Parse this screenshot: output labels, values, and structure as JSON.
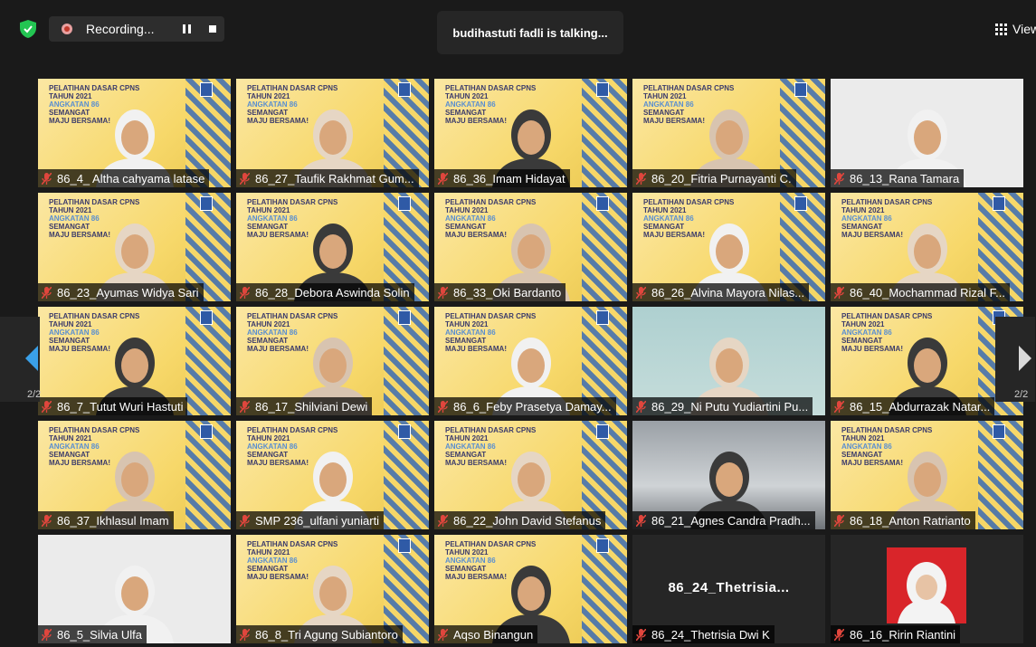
{
  "top_bar": {
    "recording_label": "Recording...",
    "talking_indicator": "budihastuti fadli is talking...",
    "view_label": "View"
  },
  "navigation": {
    "left_page": "2/2",
    "right_page": "2/2"
  },
  "participants": [
    {
      "name": "86_4_ Altha cahyama latase",
      "bg": "poster"
    },
    {
      "name": "86_27_Taufik Rakhmat Gum...",
      "bg": "poster"
    },
    {
      "name": "86_36_Imam Hidayat",
      "bg": "poster"
    },
    {
      "name": "86_20_Fitria Purnayanti C.",
      "bg": "poster"
    },
    {
      "name": "86_13_Rana Tamara",
      "bg": "light"
    },
    {
      "name": "86_23_Ayumas Widya Sari",
      "bg": "poster"
    },
    {
      "name": "86_28_Debora Aswinda Solin",
      "bg": "poster"
    },
    {
      "name": "86_33_Oki Bardanto",
      "bg": "poster"
    },
    {
      "name": "86_26_Alvina Mayora Nilas...",
      "bg": "poster"
    },
    {
      "name": "86_40_Mochammad Rizal F...",
      "bg": "poster"
    },
    {
      "name": "86_7_Tutut Wuri Hastuti",
      "bg": "poster"
    },
    {
      "name": "86_17_Shilviani Dewi",
      "bg": "poster"
    },
    {
      "name": "86_6_Feby Prasetya Damay...",
      "bg": "poster"
    },
    {
      "name": "86_29_Ni Putu Yudiartini Pu...",
      "bg": "teal"
    },
    {
      "name": "86_15_Abdurrazak Natar...",
      "bg": "poster"
    },
    {
      "name": "86_37_Ikhlasul Imam",
      "bg": "poster"
    },
    {
      "name": "SMP 236_ulfani yuniarti",
      "bg": "poster"
    },
    {
      "name": "86_22_John David Stefanus",
      "bg": "poster"
    },
    {
      "name": "86_21_Agnes Candra Pradh...",
      "bg": "grey"
    },
    {
      "name": "86_18_Anton Ratrianto",
      "bg": "poster"
    },
    {
      "name": "86_5_Silvia Ulfa",
      "bg": "light"
    },
    {
      "name": "86_8_Tri Agung Subiantoro",
      "bg": "poster"
    },
    {
      "name": "Aqso Binangun",
      "bg": "poster"
    },
    {
      "name": "86_24_Thetrisia Dwi K",
      "bg": "black",
      "center_label": "86_24_Thetrisia..."
    },
    {
      "name": "86_16_Ririn Riantini",
      "bg": "photo"
    }
  ],
  "poster_text": {
    "line1": "PELATIHAN DASAR CPNS",
    "line2": "TAHUN 2021",
    "line3": "ANGKATAN 86",
    "line4": "SEMANGAT",
    "line5": "MAJU BERSAMA!"
  },
  "colors": {
    "active_speaker": "#6ee36e",
    "muted_mic": "#e0463d",
    "recording_dot": "#c0392b",
    "accent_blue": "#3aa0e8"
  }
}
